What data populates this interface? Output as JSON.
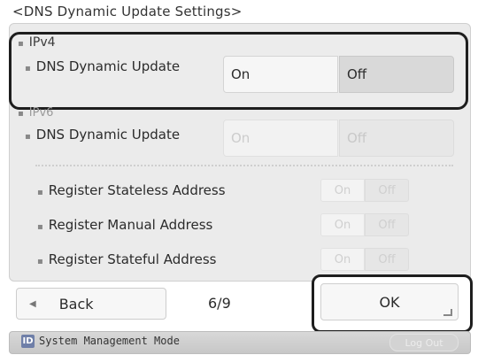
{
  "title": "<DNS Dynamic Update Settings>",
  "ipv4": {
    "section_label": "IPv4",
    "row_label": "DNS Dynamic Update",
    "on_label": "On",
    "off_label": "Off",
    "selected": "Off"
  },
  "ipv6": {
    "section_label": "IPv6",
    "row_label": "DNS Dynamic Update",
    "on_label": "On",
    "off_label": "Off",
    "sub_rows": [
      {
        "label": "Register Stateless Address",
        "on_label": "On",
        "off_label": "Off"
      },
      {
        "label": "Register Manual Address",
        "on_label": "On",
        "off_label": "Off"
      },
      {
        "label": "Register Stateful Address",
        "on_label": "On",
        "off_label": "Off"
      }
    ]
  },
  "footer": {
    "back_label": "Back",
    "page_indicator": "6/9",
    "ok_label": "OK"
  },
  "status_bar": {
    "icon_letter": "ID",
    "mode_text": "System Management Mode",
    "logout_label": "Log Out"
  }
}
